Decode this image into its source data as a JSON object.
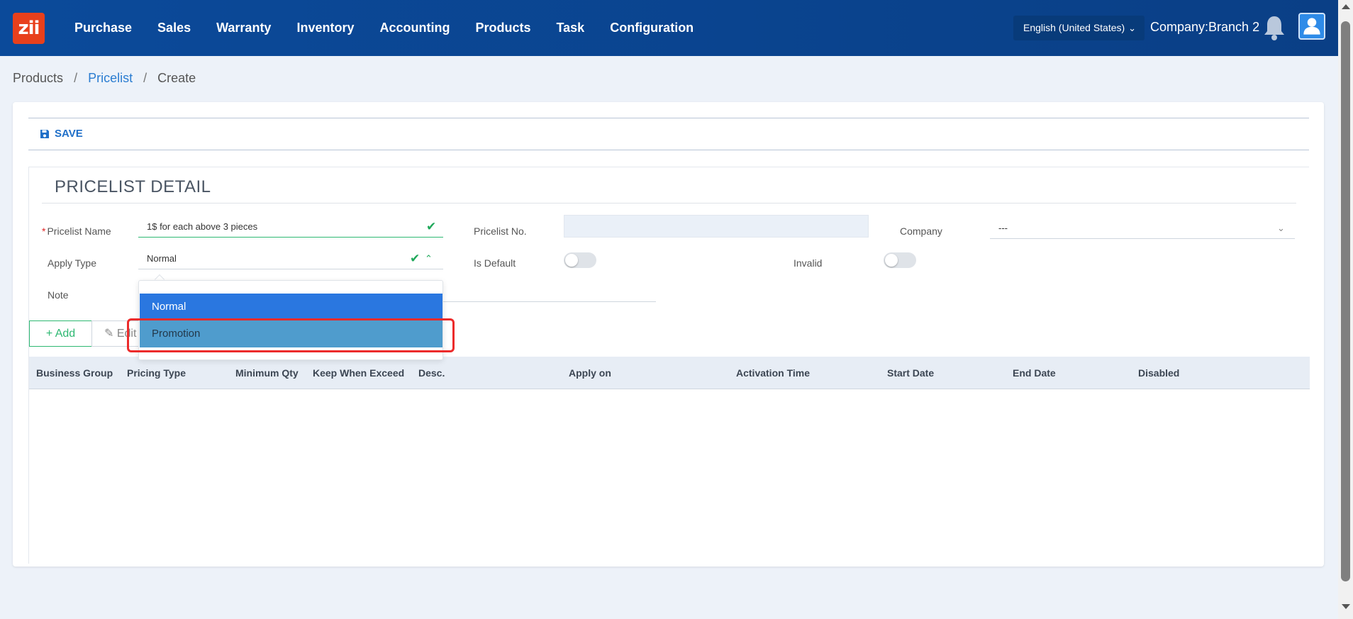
{
  "nav": {
    "logo": "zii",
    "items": [
      "Purchase",
      "Sales",
      "Warranty",
      "Inventory",
      "Accounting",
      "Products",
      "Task",
      "Configuration"
    ],
    "language": "English (United States)",
    "company": "Company:Branch 2"
  },
  "breadcrumb": {
    "root": "Products",
    "parent": "Pricelist",
    "current": "Create",
    "separator": "/"
  },
  "toolbar": {
    "save_label": "SAVE"
  },
  "detail": {
    "title": "PRICELIST DETAIL",
    "pricelist_name_label": "Pricelist Name",
    "pricelist_name_value": "1$ for each above 3 pieces",
    "pricelist_no_label": "Pricelist No.",
    "pricelist_no_value": "",
    "company_label": "Company",
    "company_value": "---",
    "apply_type_label": "Apply Type",
    "apply_type_value": "Normal",
    "is_default_label": "Is Default",
    "invalid_label": "Invalid",
    "note_label": "Note"
  },
  "dropdown": {
    "options": [
      "Normal",
      "Promotion"
    ],
    "selected": "Normal",
    "hovered": "Promotion"
  },
  "actions": {
    "add_label": "Add",
    "edit_label": "Edit"
  },
  "table": {
    "columns": [
      "Business Group",
      "Pricing Type",
      "Minimum Qty",
      "Keep When Exceed",
      "Desc.",
      "Apply on",
      "Activation Time",
      "Start Date",
      "End Date",
      "Disabled"
    ]
  },
  "colors": {
    "nav_bg": "#0b4a9a",
    "accent": "#2a77e0",
    "valid": "#2eb872",
    "highlight": "#ec2b2b"
  }
}
